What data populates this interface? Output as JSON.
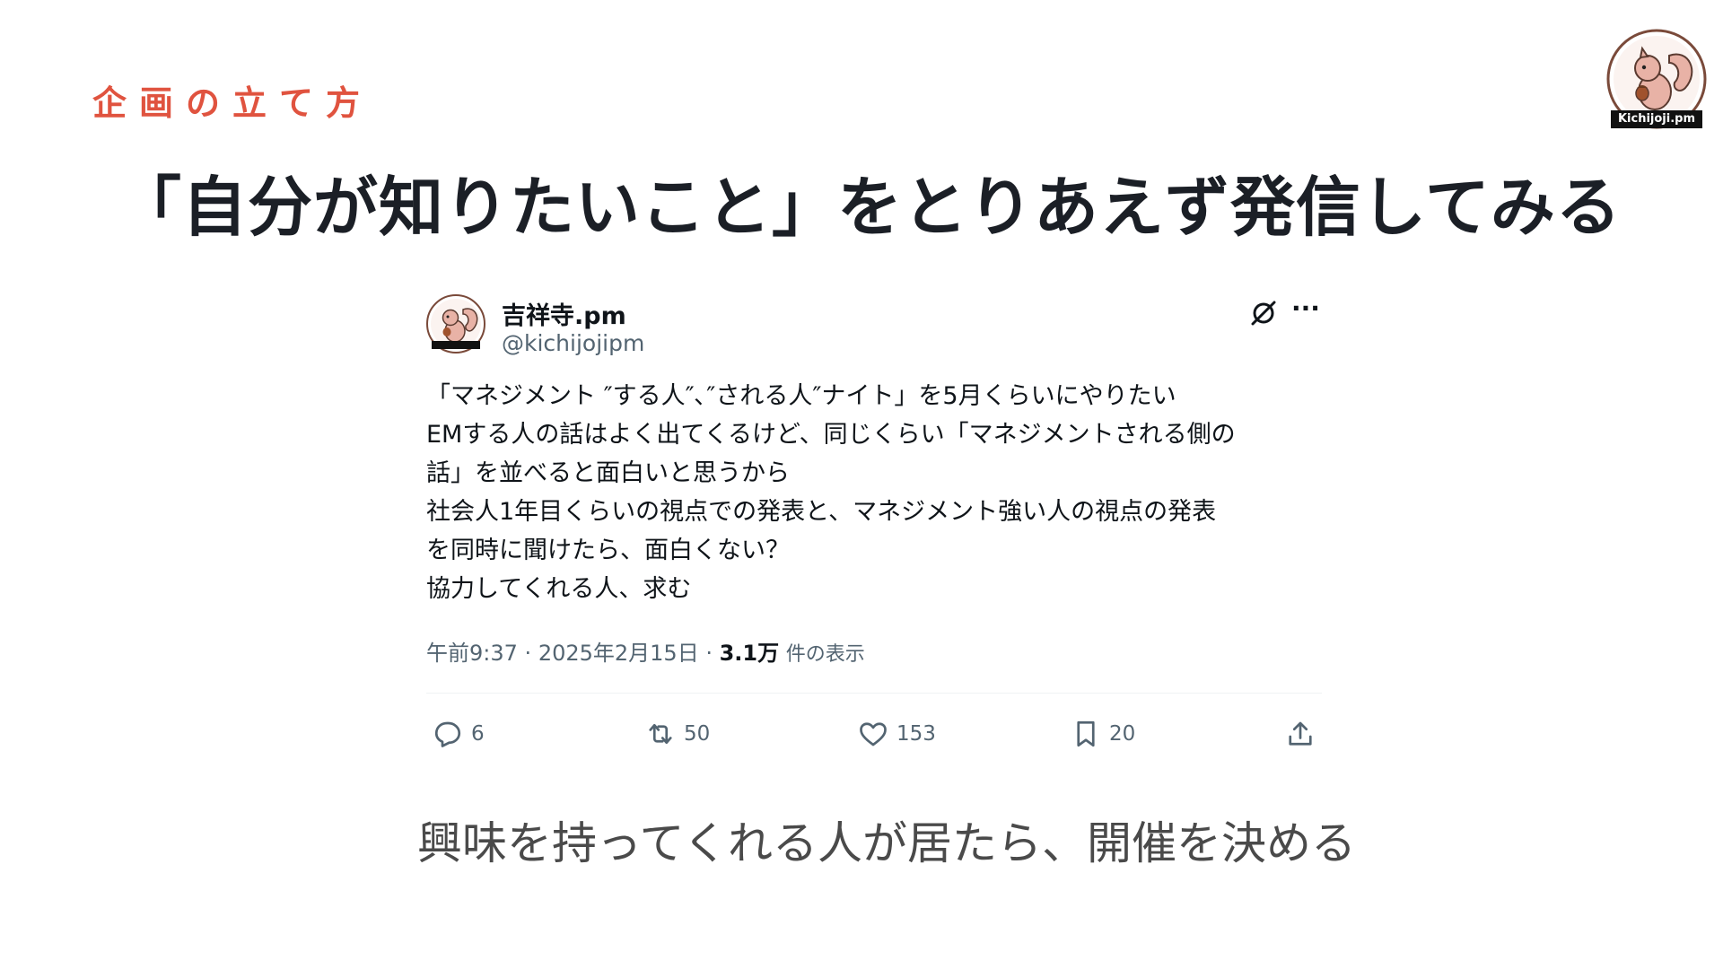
{
  "slide": {
    "section_label": "企画の立て方",
    "title": "「自分が知りたいこと」をとりあえず発信してみる",
    "footer": "興味を持ってくれる人が居たら、開催を決める",
    "logo_text": "Kichijoji.pm"
  },
  "tweet": {
    "display_name": "吉祥寺.pm",
    "handle": "@kichijojipm",
    "avatar_icon": "squirrel-avatar-icon",
    "body_lines": [
      "「マネジメント ″する人″､″される人″ナイト」を5月くらいにやりたい",
      "EMする人の話はよく出てくるけど、同じくらい「マネジメントされる側の",
      "話」を並べると面白いと思うから",
      "社会人1年目くらいの視点での発表と、マネジメント強い人の視点の発表",
      "を同時に聞けたら、面白くない？",
      "協力してくれる人、求む"
    ],
    "time": "午前9:37",
    "date": "2025年2月15日",
    "views_count": "3.1万",
    "views_label": "件の表示",
    "actions": {
      "reply_count": "6",
      "retweet_count": "50",
      "like_count": "153",
      "bookmark_count": "20"
    }
  },
  "colors": {
    "accent": "#e0533f",
    "title": "#1b1f26",
    "tweet_text": "#0f1419",
    "tweet_secondary": "#536471",
    "divider": "#eff3f4"
  }
}
